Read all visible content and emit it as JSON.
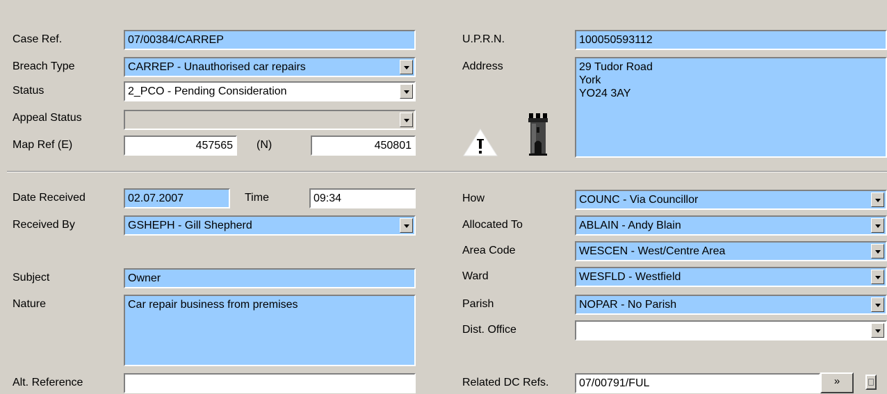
{
  "case": {
    "case_ref_label": "Case Ref.",
    "case_ref_value": "07/00384/CARREP",
    "breach_type_label": "Breach Type",
    "breach_type_value": "CARREP - Unauthorised car repairs",
    "status_label": "Status",
    "status_value": "2_PCO - Pending Consideration",
    "appeal_status_label": "Appeal Status",
    "appeal_status_value": "",
    "map_ref_e_label": "Map Ref (E)",
    "map_ref_e_value": "457565",
    "map_ref_n_label": "(N)",
    "map_ref_n_value": "450801"
  },
  "property": {
    "uprn_label": "U.P.R.N.",
    "uprn_value": "100050593112",
    "address_label": "Address",
    "address_value": "29 Tudor Road\nYork\nYO24 3AY",
    "icons": [
      "warning-icon",
      "castle-tower-icon"
    ]
  },
  "details": {
    "date_received_label": "Date Received",
    "date_received_value": "02.07.2007",
    "time_label": "Time",
    "time_value": "09:34",
    "received_by_label": "Received By",
    "received_by_value": "GSHEPH - Gill Shepherd",
    "subject_label": "Subject",
    "subject_value": "Owner",
    "nature_label": "Nature",
    "nature_value": "Car repair business from premises",
    "alt_reference_label": "Alt. Reference",
    "alt_reference_value": ""
  },
  "assignment": {
    "how_label": "How",
    "how_value": "COUNC - Via Councillor",
    "allocated_to_label": "Allocated To",
    "allocated_to_value": "ABLAIN - Andy Blain",
    "area_code_label": "Area Code",
    "area_code_value": "WESCEN - West/Centre Area",
    "ward_label": "Ward",
    "ward_value": "WESFLD - Westfield",
    "parish_label": "Parish",
    "parish_value": "NOPAR - No Parish",
    "dist_office_label": "Dist. Office",
    "dist_office_value": "",
    "related_dc_label": "Related DC Refs.",
    "related_dc_value": "07/00791/FUL",
    "related_dc_button": "»"
  },
  "colors": {
    "window_bg": "#d4d0c8",
    "field_highlight": "#99ccff",
    "field_plain": "#ffffff"
  }
}
